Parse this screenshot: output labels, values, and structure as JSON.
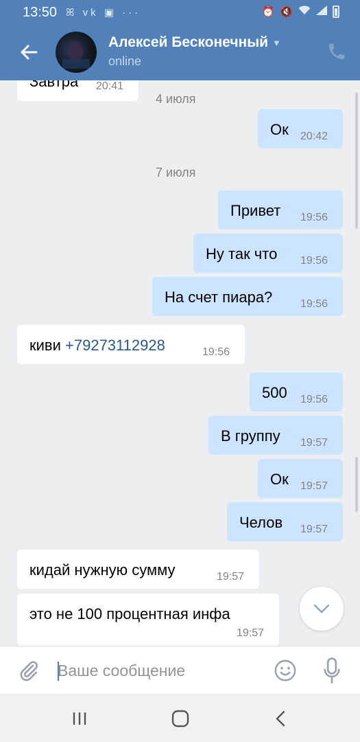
{
  "status_bar": {
    "time": "13:50",
    "left_icons": "ꕤ vk ▣ ···",
    "right_icons": [
      "alarm-icon",
      "mute-icon",
      "wifi-icon",
      "signal-icon",
      "battery-icon"
    ]
  },
  "header": {
    "contact_name": "Алексей Бесконечный",
    "status": "online"
  },
  "messages": [
    {
      "dir": "in",
      "text": "Завтра",
      "time": "20:41"
    },
    {
      "type": "date",
      "text": "4 июля"
    },
    {
      "dir": "out",
      "text": "Ок",
      "time": "20:42"
    },
    {
      "type": "date",
      "text": "7 июля"
    },
    {
      "dir": "out",
      "text": "Привет",
      "time": "19:56"
    },
    {
      "dir": "out",
      "text": "Ну так что",
      "time": "19:56"
    },
    {
      "dir": "out",
      "text": "На счет пиара?",
      "time": "19:56"
    },
    {
      "dir": "in",
      "text": "киви",
      "phone": "+79273112928",
      "time": "19:56"
    },
    {
      "dir": "out",
      "text": "500",
      "time": "19:56"
    },
    {
      "dir": "out",
      "text": "В группу",
      "time": "19:57"
    },
    {
      "dir": "out",
      "text": "Ок",
      "time": "19:57"
    },
    {
      "dir": "out",
      "text": "Челов",
      "time": "19:57"
    },
    {
      "dir": "in",
      "text": "кидай нужную сумму",
      "time": "19:57"
    },
    {
      "dir": "in",
      "text": "это не 100 процентная инфа",
      "time": "19:57"
    }
  ],
  "composer": {
    "placeholder": "Ваше сообщение"
  },
  "colors": {
    "header": "#5181b8",
    "incoming": "#ffffff",
    "outgoing": "#cce4ff",
    "link": "#2a5885",
    "background": "#edeef0"
  }
}
